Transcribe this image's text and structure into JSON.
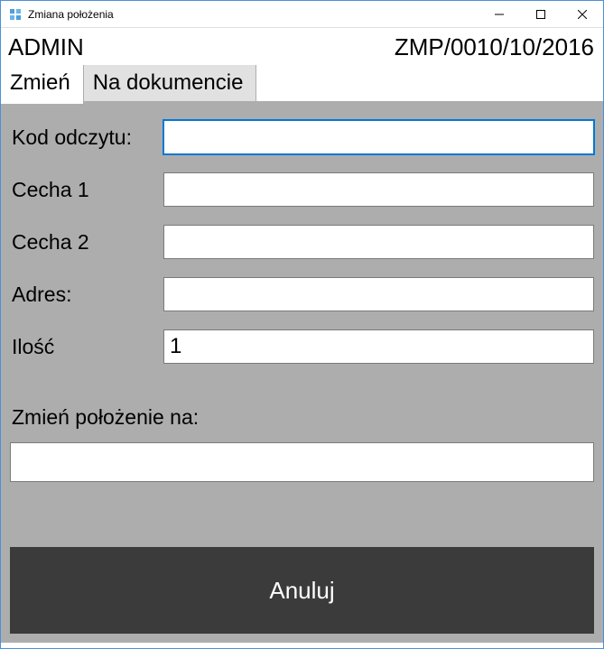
{
  "window": {
    "title": "Zmiana położenia"
  },
  "header": {
    "user": "ADMIN",
    "doc": "ZMP/0010/10/2016"
  },
  "tabs": {
    "change": "Zmień",
    "onDocument": "Na dokumencie"
  },
  "form": {
    "kodOdczytu": {
      "label": "Kod odczytu:",
      "value": ""
    },
    "cecha1": {
      "label": "Cecha 1",
      "value": ""
    },
    "cecha2": {
      "label": "Cecha 2",
      "value": ""
    },
    "adres": {
      "label": "Adres:",
      "value": ""
    },
    "ilosc": {
      "label": "Ilość",
      "value": "1"
    }
  },
  "changeLocation": {
    "label": "Zmień położenie na:",
    "value": ""
  },
  "buttons": {
    "cancel": "Anuluj"
  }
}
